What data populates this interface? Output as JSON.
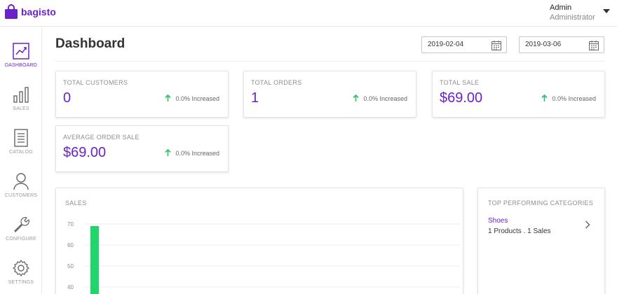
{
  "app": {
    "brand": "bagisto"
  },
  "user": {
    "name": "Admin",
    "role": "Administrator"
  },
  "sidebar": {
    "items": [
      {
        "label": "DASHBOARD",
        "icon": "dashboard-chart-icon",
        "active": true
      },
      {
        "label": "SALES",
        "icon": "bar-chart-icon"
      },
      {
        "label": "CATALOG",
        "icon": "document-list-icon"
      },
      {
        "label": "CUSTOMERS",
        "icon": "person-icon"
      },
      {
        "label": "CONFIGURE",
        "icon": "wrench-icon"
      },
      {
        "label": "SETTINGS",
        "icon": "gear-icon"
      }
    ]
  },
  "page": {
    "title": "Dashboard"
  },
  "filters": {
    "start_date": "2019-02-04",
    "end_date": "2019-03-06"
  },
  "stats": [
    {
      "title": "TOTAL CUSTOMERS",
      "value": "0",
      "trend": "0.0% Increased"
    },
    {
      "title": "TOTAL ORDERS",
      "value": "1",
      "trend": "0.0% Increased"
    },
    {
      "title": "TOTAL SALE",
      "value": "$69.00",
      "trend": "0.0% Increased"
    },
    {
      "title": "AVERAGE ORDER SALE",
      "value": "$69.00",
      "trend": "0.0% Increased"
    }
  ],
  "sales_panel": {
    "title": "SALES"
  },
  "top_categories": {
    "title": "TOP PERFORMING CATEGORIES",
    "items": [
      {
        "name": "Shoes",
        "products": "1 Products",
        "separator": ".",
        "sales": "1 Sales"
      }
    ]
  },
  "colors": {
    "accent": "#6b22c8",
    "trend_up": "#2bbf6a",
    "bar": "#1fd66b"
  },
  "chart_data": {
    "type": "bar",
    "title": "",
    "xlabel": "",
    "ylabel": "",
    "y_ticks": [
      "70",
      "60",
      "50",
      "40"
    ],
    "ylim": [
      40,
      70
    ],
    "series": [
      {
        "values": [
          69
        ]
      }
    ],
    "grid": true
  }
}
